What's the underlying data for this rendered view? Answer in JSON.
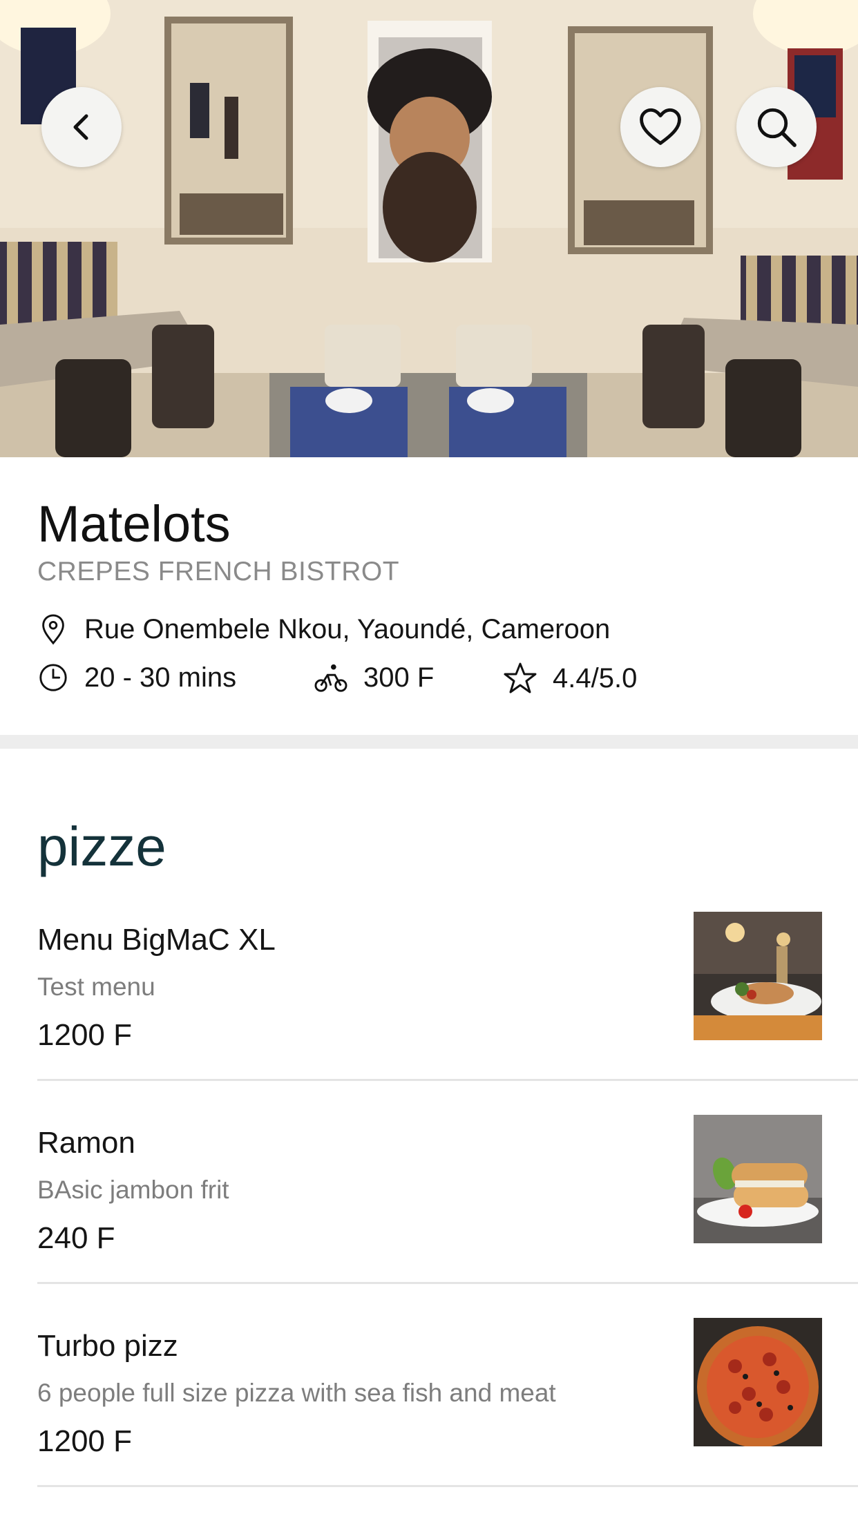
{
  "header": {
    "back_icon": "chevron-left-icon",
    "favorite_icon": "heart-icon",
    "search_icon": "search-icon"
  },
  "restaurant": {
    "name": "Matelots",
    "category": "CREPES FRENCH BISTROT",
    "address": "Rue Onembele Nkou, Yaoundé, Cameroon",
    "delivery_time": "20 - 30 mins",
    "delivery_fee": "300 F",
    "rating": "4.4/5.0"
  },
  "menu": {
    "section_title": "pizze",
    "items": [
      {
        "name": "Menu BigMaC XL",
        "description": "Test menu",
        "price": "1200 F"
      },
      {
        "name": "Ramon",
        "description": "BAsic jambon frit",
        "price": "240 F"
      },
      {
        "name": "Turbo pizz",
        "description": "6 people full size pizza with sea fish and meat",
        "price": "1200 F"
      }
    ]
  }
}
